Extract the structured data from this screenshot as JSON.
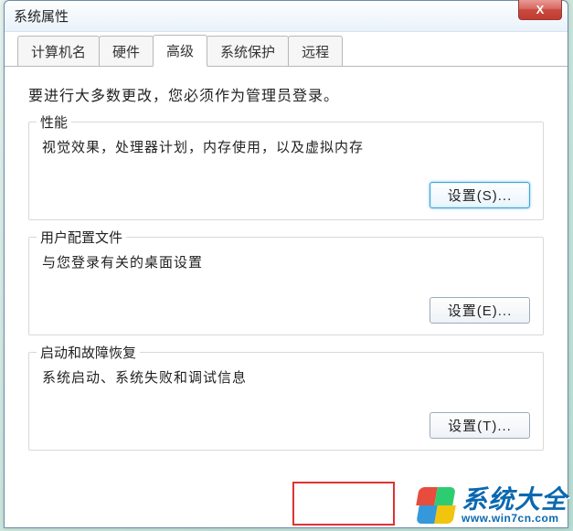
{
  "window": {
    "title": "系统属性",
    "close_glyph": "X"
  },
  "tabs": [
    {
      "label": "计算机名"
    },
    {
      "label": "硬件"
    },
    {
      "label": "高级"
    },
    {
      "label": "系统保护"
    },
    {
      "label": "远程"
    }
  ],
  "active_tab_index": 2,
  "content": {
    "admin_note": "要进行大多数更改，您必须作为管理员登录。",
    "groups": [
      {
        "title": "性能",
        "desc": "视觉效果，处理器计划，内存使用，以及虚拟内存",
        "button": "设置(S)...",
        "highlight": true
      },
      {
        "title": "用户配置文件",
        "desc": "与您登录有关的桌面设置",
        "button": "设置(E)...",
        "highlight": false
      },
      {
        "title": "启动和故障恢复",
        "desc": "系统启动、系统失败和调试信息",
        "button": "设置(T)...",
        "highlight": false
      }
    ]
  },
  "watermark": {
    "text": "系统大全",
    "url": "www.win7cn.com"
  }
}
